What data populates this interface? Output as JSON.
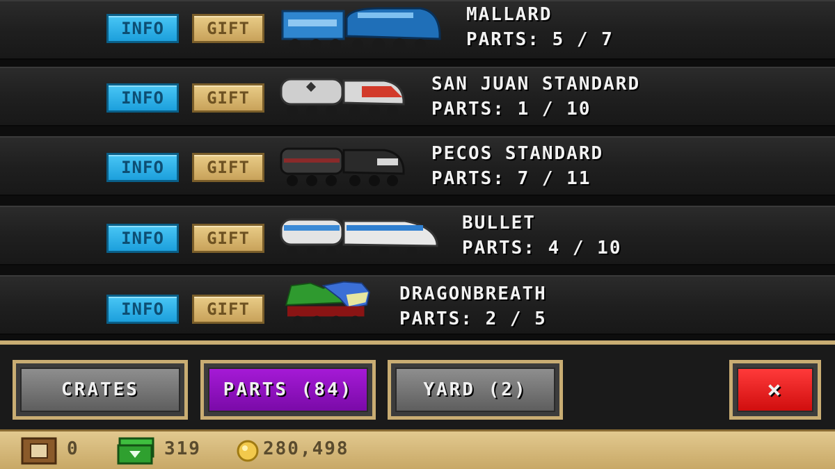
{
  "rows": [
    {
      "name": "MALLARD",
      "parts": "PARTS: 5 / 7",
      "info_label": "INFO",
      "gift_label": "GIFT",
      "train_colors": [
        "#3a8fd6",
        "#1f6fb8"
      ]
    },
    {
      "name": "SAN JUAN STANDARD",
      "parts": "PARTS: 1 / 10",
      "info_label": "INFO",
      "gift_label": "GIFT",
      "train_colors": [
        "#d6d6d6",
        "#d23a2a"
      ]
    },
    {
      "name": "PECOS STANDARD",
      "parts": "PARTS: 7 / 11",
      "info_label": "INFO",
      "gift_label": "GIFT",
      "train_colors": [
        "#3a3a3a",
        "#b02020"
      ]
    },
    {
      "name": "BULLET",
      "parts": "PARTS: 4 / 10",
      "info_label": "INFO",
      "gift_label": "GIFT",
      "train_colors": [
        "#e8e8e8",
        "#2f7fd0"
      ]
    },
    {
      "name": "DRAGONBREATH",
      "parts": "PARTS: 2 / 5",
      "info_label": "INFO",
      "gift_label": "GIFT",
      "train_colors": [
        "#2f9a2f",
        "#c81f1f"
      ]
    }
  ],
  "tabs": {
    "crates": "CRATES",
    "parts": "PARTS (84)",
    "yard": "YARD (2)",
    "close": "×"
  },
  "status": {
    "crates_count": "0",
    "cash": "319",
    "coins": "280,498"
  },
  "colors": {
    "info": "#1c9fdc",
    "gift": "#c8a25a",
    "active_tab": "#8a12bd",
    "close": "#e01818",
    "gold": "#c9ad73"
  }
}
